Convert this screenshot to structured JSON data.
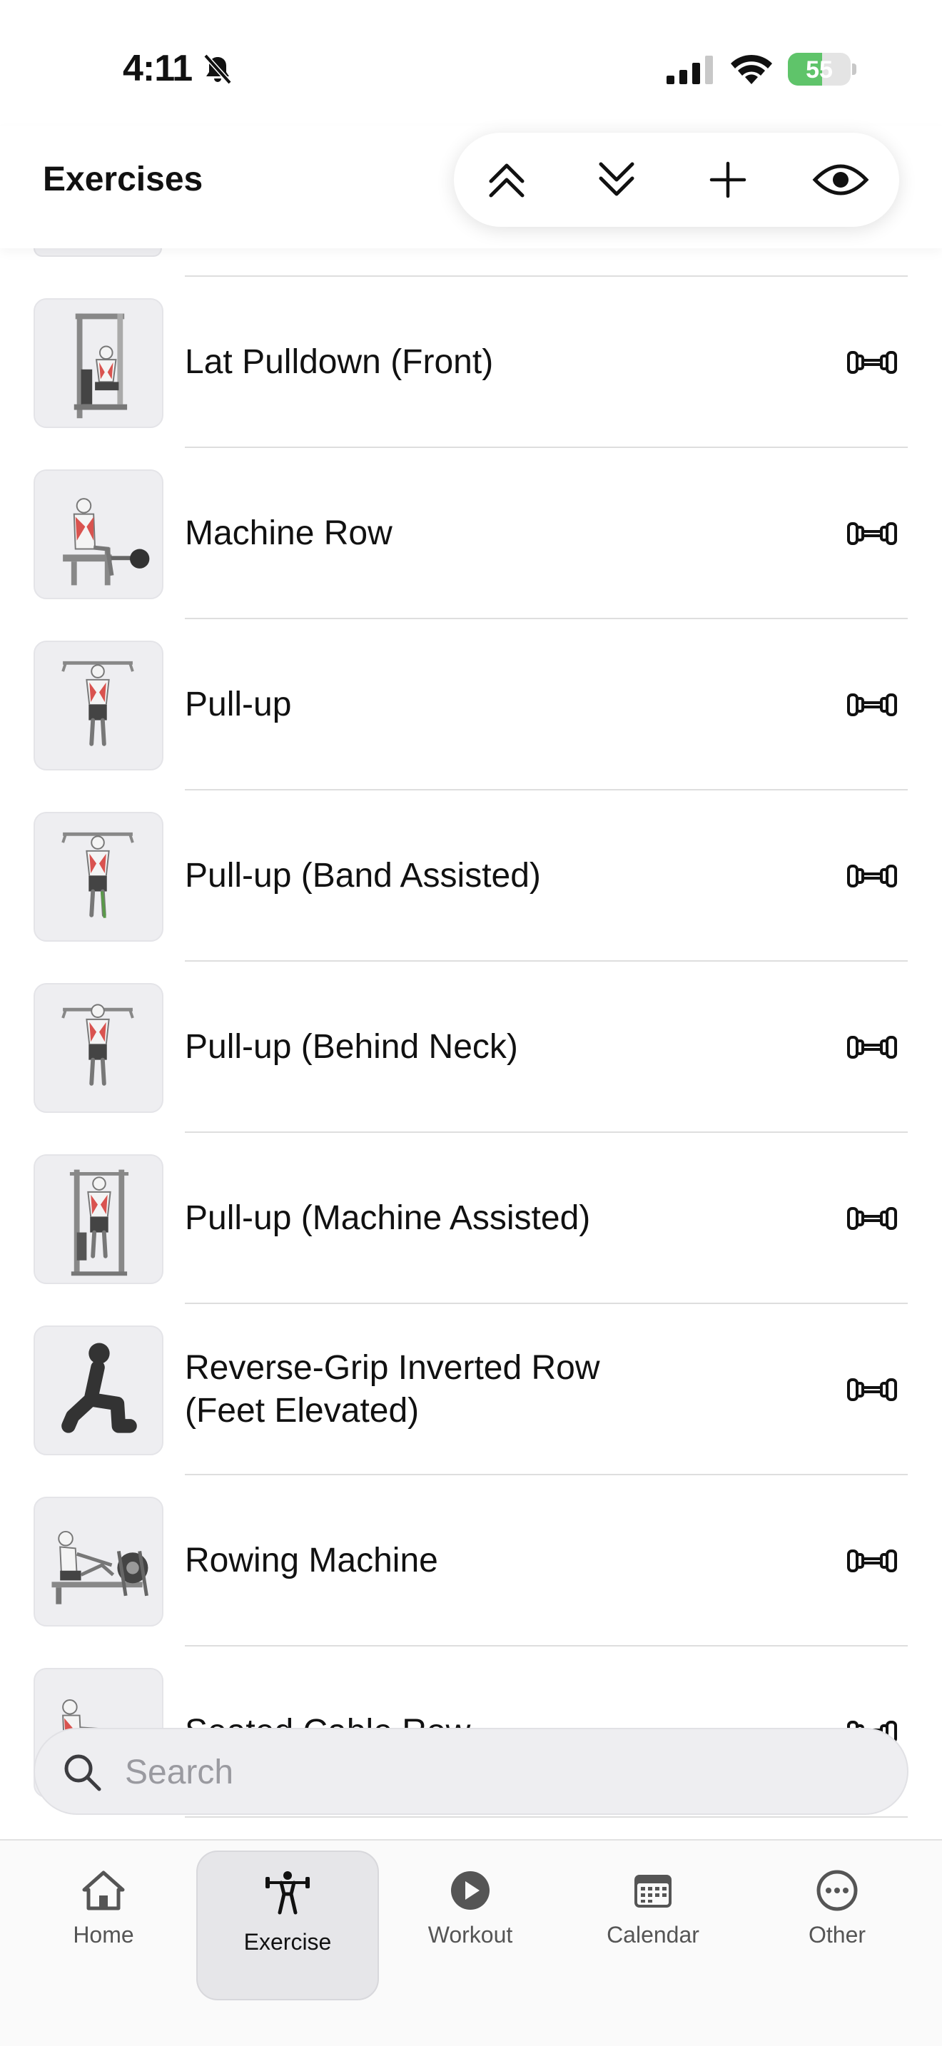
{
  "status_bar": {
    "time": "4:11",
    "battery_percent": "55",
    "battery_level": 0.55,
    "icons": [
      "bell-slash-icon",
      "cellular-signal-icon",
      "wifi-icon",
      "battery-charging-icon"
    ]
  },
  "header": {
    "title": "Exercises",
    "toolbar_icons": [
      "collapse-all-icon",
      "expand-all-icon",
      "add-icon",
      "visibility-icon"
    ]
  },
  "exercises": [
    {
      "name": "Lat Pulldown (Front)",
      "thumb": "lat-pulldown",
      "equipment_icon": "dumbbell-icon"
    },
    {
      "name": "Machine Row",
      "thumb": "machine-row",
      "equipment_icon": "dumbbell-icon"
    },
    {
      "name": "Pull-up",
      "thumb": "pull-up",
      "equipment_icon": "dumbbell-icon"
    },
    {
      "name": "Pull-up (Band Assisted)",
      "thumb": "pull-up-band",
      "equipment_icon": "dumbbell-icon"
    },
    {
      "name": "Pull-up (Behind Neck)",
      "thumb": "pull-up-behind-neck",
      "equipment_icon": "dumbbell-icon"
    },
    {
      "name": "Pull-up (Machine Assisted)",
      "thumb": "pull-up-machine",
      "equipment_icon": "dumbbell-icon"
    },
    {
      "name": "Reverse-Grip Inverted Row\n(Feet Elevated)",
      "thumb": "generic-lunge",
      "equipment_icon": "dumbbell-icon"
    },
    {
      "name": "Rowing Machine",
      "thumb": "rowing-machine",
      "equipment_icon": "dumbbell-icon"
    },
    {
      "name": "Seated Cable Row",
      "thumb": "seated-cable-row",
      "equipment_icon": "dumbbell-icon"
    }
  ],
  "search": {
    "placeholder": "Search",
    "value": ""
  },
  "tabbar": {
    "active": "Exercise",
    "tabs": [
      {
        "label": "Home",
        "icon": "home-icon"
      },
      {
        "label": "Exercise",
        "icon": "weightlifter-icon"
      },
      {
        "label": "Workout",
        "icon": "play-circle-icon"
      },
      {
        "label": "Calendar",
        "icon": "calendar-icon"
      },
      {
        "label": "Other",
        "icon": "ellipsis-circle-icon"
      }
    ]
  }
}
